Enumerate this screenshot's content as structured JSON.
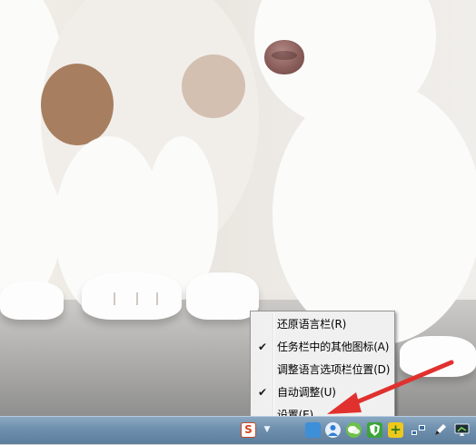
{
  "context_menu": {
    "items": [
      {
        "label": "还原语言栏(R)",
        "checked": false
      },
      {
        "label": "任务栏中的其他图标(A)",
        "checked": true
      },
      {
        "label": "调整语言选项栏位置(D)",
        "checked": false
      },
      {
        "label": "自动调整(U)",
        "checked": true
      },
      {
        "label": "设置(E)...",
        "checked": false
      }
    ],
    "check_glyph": "✔"
  },
  "taskbar": {
    "tray_icons": [
      {
        "name": "sogou-input-icon",
        "glyph": "S"
      },
      {
        "name": "chevron-down-icon",
        "glyph": "▼"
      },
      {
        "name": "box-icon",
        "glyph": ""
      },
      {
        "name": "user-icon",
        "glyph": ""
      },
      {
        "name": "wechat-icon",
        "glyph": ""
      },
      {
        "name": "shield-icon",
        "glyph": ""
      },
      {
        "name": "plus-icon",
        "glyph": "+"
      },
      {
        "name": "network-icon",
        "glyph": ""
      },
      {
        "name": "pen-icon",
        "glyph": ""
      },
      {
        "name": "monitor-icon",
        "glyph": ""
      }
    ]
  },
  "annotation": {
    "arrow_color": "#e0312f"
  }
}
